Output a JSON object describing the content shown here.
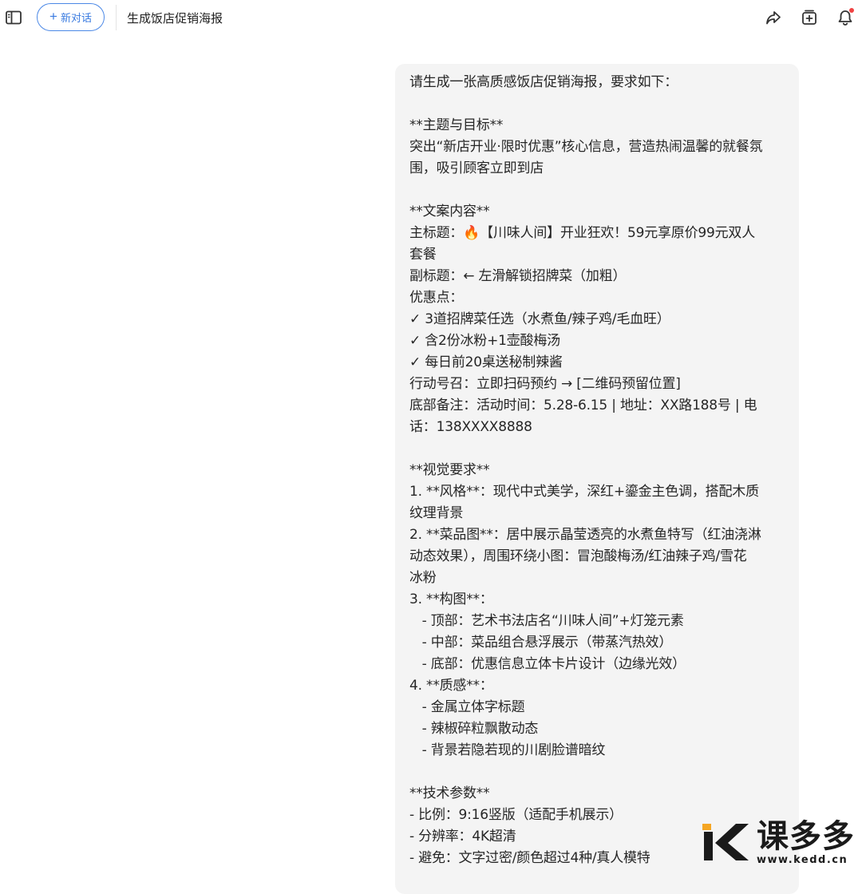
{
  "header": {
    "new_chat_label": "新对话",
    "new_chat_plus": "+",
    "conversation_title": "生成饭店促销海报",
    "icons": {
      "sidebar": "sidebar-toggle-icon",
      "share": "share-icon",
      "add": "add-to-collection-icon",
      "bell": "notification-bell-icon"
    },
    "notification_dot_color": "#f04343",
    "accent_color": "#3a7be0"
  },
  "message": {
    "role": "user",
    "lines": [
      "请生成一张高质感饭店促销海报，要求如下：",
      "",
      "**主题与目标**",
      "突出“新店开业·限时优惠”核心信息，营造热闹温馨的就餐氛",
      "围，吸引顾客立即到店",
      "",
      "**文案内容**",
      "主标题：🔥【川味人间】开业狂欢！59元享原价99元双人",
      "套餐",
      "副标题：← 左滑解锁招牌菜（加粗）",
      "优惠点：",
      "✓ 3道招牌菜任选（水煮鱼/辣子鸡/毛血旺）",
      "✓ 含2份冰粉+1壶酸梅汤",
      "✓ 每日前20桌送秘制辣酱",
      "行动号召：立即扫码预约 → [二维码预留位置]",
      "底部备注：活动时间：5.28-6.15 | 地址：XX路188号 | 电",
      "话：138XXXX8888",
      "",
      "**视觉要求**",
      "1. **风格**：现代中式美学，深红+鎏金主色调，搭配木质",
      "纹理背景",
      "2. **菜品图**：居中展示晶莹透亮的水煮鱼特写（红油浇淋",
      "动态效果），周围环绕小图：冒泡酸梅汤/红油辣子鸡/雪花",
      "冰粉",
      "3. **构图**：",
      "   - 顶部：艺术书法店名“川味人间”+灯笼元素",
      "   - 中部：菜品组合悬浮展示（带蒸汽热效）",
      "   - 底部：优惠信息立体卡片设计（边缘光效）",
      "4. **质感**：",
      "   - 金属立体字标题",
      "   - 辣椒碎粒飘散动态",
      "   - 背景若隐若现的川剧脸谱暗纹",
      "",
      "**技术参数**",
      "- 比例：9:16竖版（适配手机展示）",
      "- 分辨率：4K超清",
      "- 避免：文字过密/颜色超过4种/真人模特"
    ]
  },
  "watermark": {
    "name": "课多多",
    "url": "www.kedd.cn",
    "logo_icon": "kedd-logo-icon",
    "logo_colors": [
      "#f5a623",
      "#1a1a1a"
    ]
  }
}
